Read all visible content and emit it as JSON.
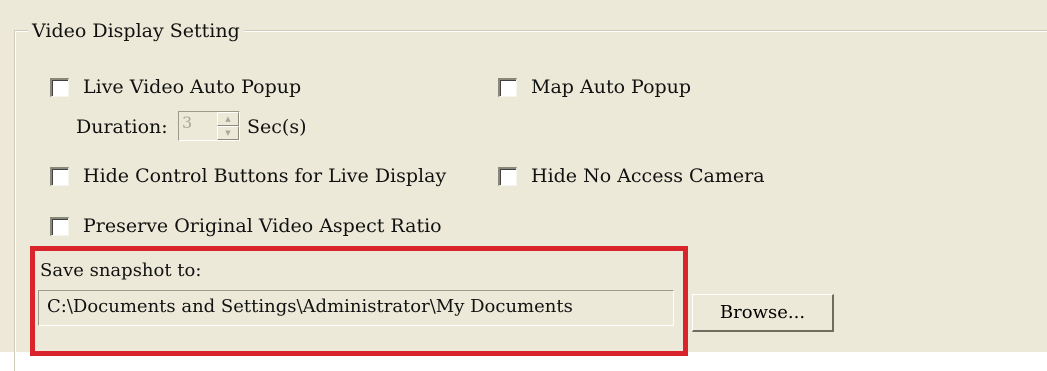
{
  "group": {
    "title": "Video Display Setting"
  },
  "options": {
    "live_video_auto_popup": "Live Video Auto Popup",
    "map_auto_popup": "Map Auto Popup",
    "hide_control_buttons": "Hide Control Buttons for Live Display",
    "hide_no_access_camera": "Hide No Access Camera",
    "preserve_aspect_ratio": "Preserve Original Video Aspect Ratio"
  },
  "duration": {
    "label": "Duration:",
    "value": "3",
    "unit": "Sec(s)",
    "disabled": true
  },
  "snapshot": {
    "label": "Save snapshot to:",
    "path": "C:\\Documents and Settings\\Administrator\\My Documents",
    "browse_label": "Browse..."
  },
  "colors": {
    "panel_bg": "#ece9d8",
    "highlight": "#d9242b"
  }
}
